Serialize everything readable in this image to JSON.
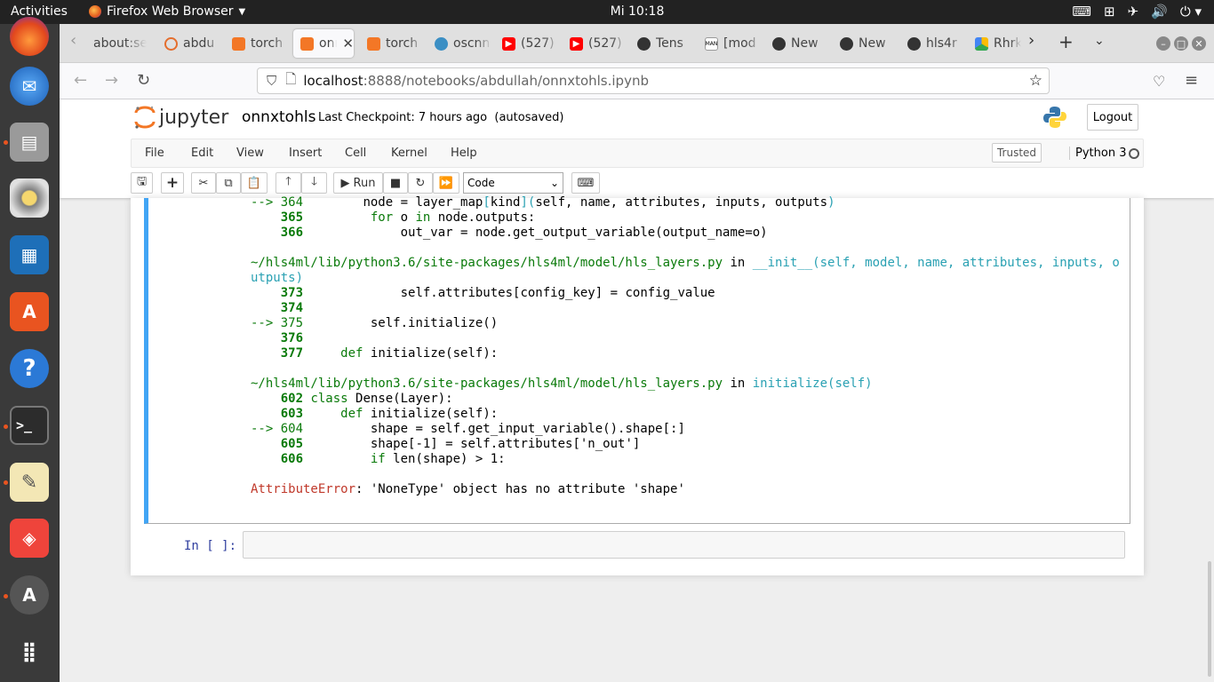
{
  "topbar": {
    "activities": "Activities",
    "app_name": "Firefox Web Browser",
    "clock": "Mi 10:18"
  },
  "dock": {
    "items": [
      "firefox-icon",
      "thunderbird-icon",
      "files-icon",
      "rhythmbox-icon",
      "writer-icon",
      "software-icon",
      "help-icon",
      "terminal-icon",
      "text-editor-icon",
      "anydesk-icon",
      "updater-icon",
      "apps-grid-icon"
    ]
  },
  "browser": {
    "tabs": [
      {
        "label": "about:se",
        "favicon": "generic"
      },
      {
        "label": "abdu",
        "favicon": "jupyter"
      },
      {
        "label": "torch",
        "favicon": "jupyter-book"
      },
      {
        "label": "onn",
        "favicon": "jupyter-book",
        "active": true
      },
      {
        "label": "torch",
        "favicon": "jupyter-book"
      },
      {
        "label": "oscnn",
        "favicon": "globe"
      },
      {
        "label": "(527)",
        "favicon": "youtube"
      },
      {
        "label": "(527)",
        "favicon": "youtube"
      },
      {
        "label": "Tens",
        "favicon": "github"
      },
      {
        "label": "[mod",
        "favicon": "man"
      },
      {
        "label": "New",
        "favicon": "github"
      },
      {
        "label": "New",
        "favicon": "github"
      },
      {
        "label": "hls4r",
        "favicon": "github"
      },
      {
        "label": "Rhrk",
        "favicon": "drive"
      }
    ],
    "url_host": "localhost",
    "url_path": ":8888/notebooks/abdullah/onnxtohls.ipynb"
  },
  "jupyter": {
    "logo_text": "jupyter",
    "notebook_name": "onnxtohls",
    "checkpoint": "Last Checkpoint: 7 hours ago",
    "autosave": "(autosaved)",
    "logout": "Logout",
    "menu": [
      "File",
      "Edit",
      "View",
      "Insert",
      "Cell",
      "Kernel",
      "Help"
    ],
    "trusted": "Trusted",
    "kernel_name": "Python 3",
    "toolbar": {
      "run": "Run",
      "cell_type": "Code"
    },
    "traceback": {
      "l364_arrow": "--> 364",
      "l364_code_a": "        node = layer_map",
      "l364_code_b": "[",
      "l364_code_c": "kind",
      "l364_code_d": "](",
      "l364_code_e": "self, name, attributes, inputs, outputs",
      "l364_code_f": ")",
      "l365": "365",
      "l365_kw": "for",
      "l365_code": " o ",
      "l365_kw2": "in",
      "l365_code2": " node.outputs:",
      "l366": "366",
      "l366_code": "out_var = node.get_output_variable(output_name=o)",
      "file1": "~/hls4ml/lib/python3.6/site-packages/hls4ml/model/hls_layers.py",
      "in1": " in ",
      "func1": "__init__(self, model, name, attributes, inputs, o",
      "func1b": "utputs)",
      "l373": "373",
      "l373_code": "self.attributes[config_key] = config_value",
      "l374": "374",
      "l375_arrow": "--> 375",
      "l375_code": "self.initialize()",
      "l376": "376",
      "l377": "377",
      "l377_kw": "def",
      "l377_code": " initialize(self):",
      "file2": "~/hls4ml/lib/python3.6/site-packages/hls4ml/model/hls_layers.py",
      "in2": " in ",
      "func2": "initialize(self)",
      "l602": "602",
      "l602_kw": "class",
      "l602_code": " Dense(Layer):",
      "l603": "603",
      "l603_kw": "def",
      "l603_code": " initialize(self):",
      "l604_arrow": "--> 604",
      "l604_code": "shape = self.get_input_variable().shape[:]",
      "l605": "605",
      "l605_code": "shape[-1] = self.attributes['n_out']",
      "l606": "606",
      "l606_kw": "if",
      "l606_code": " len(shape) > 1:",
      "error_type": "AttributeError",
      "error_msg": ": 'NoneType' object has no attribute 'shape'"
    },
    "input_prompt": "In [ ]:"
  }
}
